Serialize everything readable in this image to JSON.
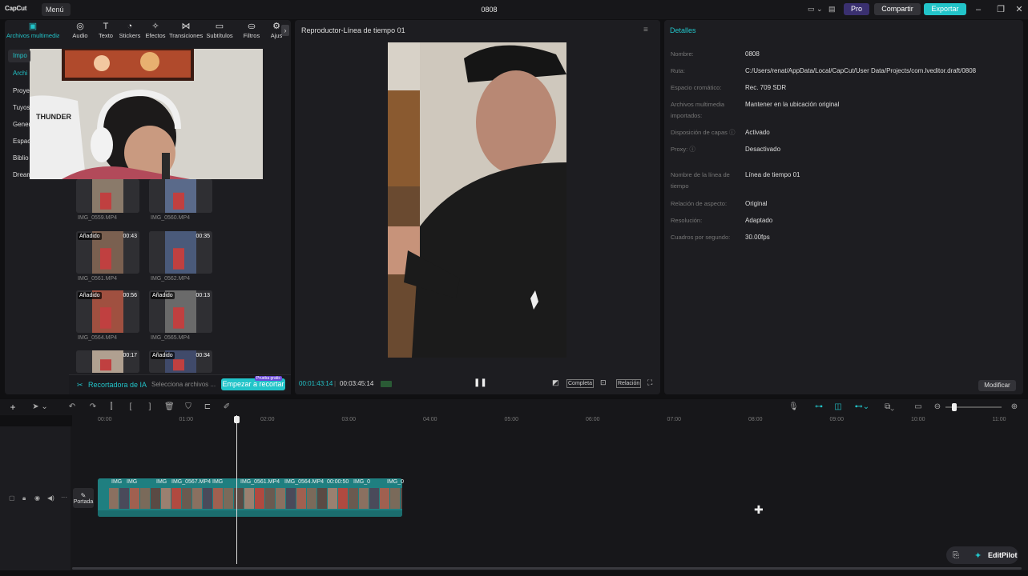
{
  "app": {
    "logo": "CapCut",
    "menu_label": "Menú ⌄",
    "project_title": "0808",
    "pro_label": "Pro",
    "share_label": "Compartir",
    "export_label": "Exportar"
  },
  "media_tabs": [
    {
      "label": "Archivos multimedia",
      "icon": "media-icon"
    },
    {
      "label": "Audio",
      "icon": "audio-icon"
    },
    {
      "label": "Texto",
      "icon": "text-icon"
    },
    {
      "label": "Stickers",
      "icon": "sticker-icon"
    },
    {
      "label": "Efectos",
      "icon": "effects-icon"
    },
    {
      "label": "Transiciones",
      "icon": "transitions-icon"
    },
    {
      "label": "Subtítulos",
      "icon": "subtitles-icon"
    },
    {
      "label": "Filtros",
      "icon": "filters-icon"
    },
    {
      "label": "Ajus",
      "icon": "adjust-icon"
    }
  ],
  "sidebar": [
    "Impo",
    "Archi",
    "Proye",
    "Tuyos",
    "Gener",
    "Espac",
    "Biblio",
    "Dream"
  ],
  "media_items": [
    {
      "name": "IMG_0559.MP4",
      "tag": "",
      "duration": ""
    },
    {
      "name": "IMG_0560.MP4",
      "tag": "",
      "duration": ""
    },
    {
      "name": "IMG_0561.MP4",
      "tag": "Añadido",
      "duration": "00:43"
    },
    {
      "name": "IMG_0562.MP4",
      "tag": "",
      "duration": "00:35"
    },
    {
      "name": "IMG_0564.MP4",
      "tag": "Añadido",
      "duration": "00:56"
    },
    {
      "name": "IMG_0565.MP4",
      "tag": "Añadido",
      "duration": "00:13"
    },
    {
      "name": "",
      "tag": "",
      "duration": "00:17"
    },
    {
      "name": "",
      "tag": "Añadido",
      "duration": "00:34"
    }
  ],
  "ai_bar": {
    "title": "Recortadora de IA",
    "select": "Selecciona archivos ...",
    "start": "Empezar a recortar",
    "badge": "Prueba gratis"
  },
  "player": {
    "title": "Reproductor-Línea de tiempo 01",
    "current": "00:01:43:14",
    "total": "00:03:45:14",
    "complete": "Completa",
    "ratio": "Relación"
  },
  "details": {
    "title": "Detalles",
    "rows": [
      {
        "label": "Nombre:",
        "value": "0808"
      },
      {
        "label": "Ruta:",
        "value": "C:/Users/renat/AppData/Local/CapCut/User Data/Projects/com.lveditor.draft/0808"
      },
      {
        "label": "Espacio cromático:",
        "value": "Rec. 709 SDR"
      },
      {
        "label": "Archivos multimedia importados:",
        "value": "Mantener en la ubicación original"
      },
      {
        "label": "Disposición de capas ⓘ",
        "value": "Activado"
      },
      {
        "label": "Proxy: ⓘ",
        "value": "Desactivado"
      },
      {
        "label": "Nombre de la línea de tiempo",
        "value": "Línea de tiempo 01"
      },
      {
        "label": "Relación de aspecto:",
        "value": "Original"
      },
      {
        "label": "Resolución:",
        "value": "Adaptado"
      },
      {
        "label": "Cuadros por segundo:",
        "value": "30.00fps"
      }
    ],
    "modify": "Modificar"
  },
  "ruler": [
    "00:00",
    "01:00",
    "02:00",
    "03:00",
    "04:00",
    "05:00",
    "06:00",
    "07:00",
    "08:00",
    "09:00",
    "10:00",
    "11:00"
  ],
  "track": {
    "cover": "Portada",
    "clip_labels": [
      "IMG",
      "IMG",
      "IMG",
      "IMG_0567.MP4",
      "IMG",
      "IMG_0561.MP4",
      "IMG_0564.MP4",
      "00:00:50",
      "IMG_0",
      "IMG_0"
    ]
  },
  "editpilot": "EditPilot",
  "colors": {
    "accent": "#22c4c9",
    "panel": "#1d1d21",
    "clip": "#1f7f80"
  }
}
